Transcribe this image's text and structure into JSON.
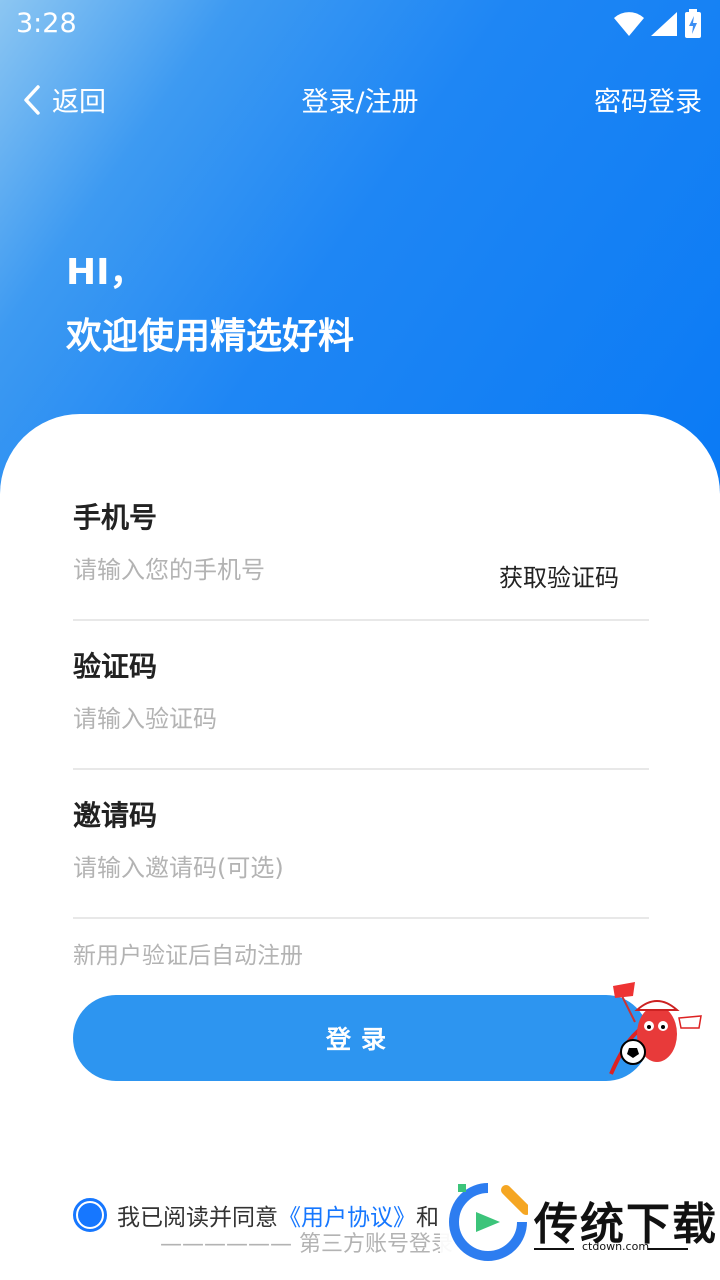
{
  "status_bar": {
    "time": "3:28"
  },
  "nav": {
    "back_label": "返回",
    "title": "登录/注册",
    "password_login": "密码登录"
  },
  "greeting": {
    "hi": "HI，",
    "welcome": "欢迎使用精选好料"
  },
  "form": {
    "phone": {
      "label": "手机号",
      "placeholder": "请输入您的手机号",
      "get_code": "获取验证码"
    },
    "code": {
      "label": "验证码",
      "placeholder": "请输入验证码"
    },
    "invite": {
      "label": "邀请码",
      "placeholder": "请输入邀请码(可选)"
    },
    "hint": "新用户验证后自动注册",
    "login_button": "登录"
  },
  "agreement": {
    "prefix": "我已阅读并同意",
    "user_agreement": "《用户协议》",
    "suffix": "和",
    "checked": true
  },
  "third_party": "—————— 第三方账号登录",
  "watermark": {
    "name": "传统下载",
    "url": "ctdown.com"
  },
  "colors": {
    "primary": "#2d95f0",
    "link": "#1677ff",
    "hero_start": "#8cc6f2",
    "hero_end": "#0a7af5"
  }
}
